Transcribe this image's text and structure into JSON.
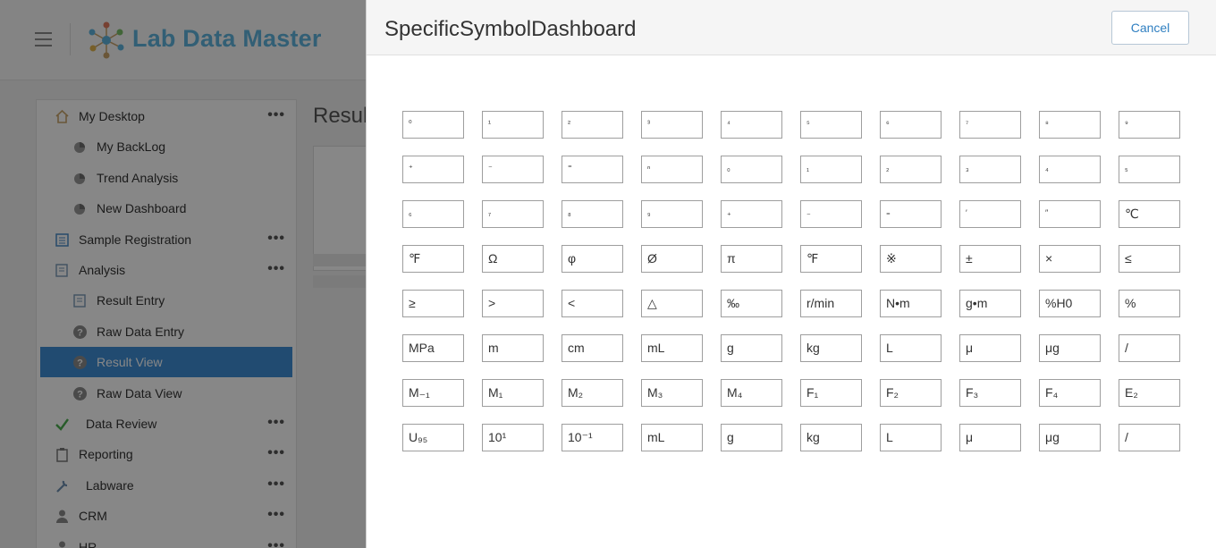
{
  "app": {
    "title": "Lab Data Master",
    "accent": "#5fb3dd"
  },
  "sidebar": {
    "items": [
      {
        "label": "My Desktop",
        "icon": "home-icon",
        "level": 0,
        "menu": true
      },
      {
        "label": "My BackLog",
        "icon": "chart-icon",
        "level": 1
      },
      {
        "label": "Trend Analysis",
        "icon": "chart-icon",
        "level": 1
      },
      {
        "label": "New Dashboard",
        "icon": "chart-icon",
        "level": 1
      },
      {
        "label": "Sample Registration",
        "icon": "form-icon",
        "level": 0,
        "menu": true
      },
      {
        "label": "Analysis",
        "icon": "edit-icon",
        "level": 0,
        "menu": true
      },
      {
        "label": "Result Entry",
        "icon": "edit-icon",
        "level": 1
      },
      {
        "label": "Raw Data Entry",
        "icon": "help-icon",
        "level": 1
      },
      {
        "label": "Result View",
        "icon": "help-icon",
        "level": 1,
        "active": true
      },
      {
        "label": "Raw Data View",
        "icon": "help-icon",
        "level": 1
      },
      {
        "label": "Data Review",
        "icon": "check-icon",
        "level": 0,
        "menu": true
      },
      {
        "label": "Reporting",
        "icon": "clipboard-icon",
        "level": 0,
        "menu": true
      },
      {
        "label": "Labware",
        "icon": "wrench-icon",
        "level": 0,
        "menu": true
      },
      {
        "label": "CRM",
        "icon": "user-icon",
        "level": 0,
        "menu": true
      },
      {
        "label": "HR",
        "icon": "user-icon",
        "level": 0,
        "menu": true
      }
    ],
    "more_label": "•••"
  },
  "content": {
    "title": "Result"
  },
  "modal": {
    "title": "SpecificSymbolDashboard",
    "cancel_label": "Cancel",
    "symbols": [
      [
        "⁰",
        "¹",
        "²",
        "³",
        "⁴",
        "⁵",
        "⁶",
        "⁷",
        "⁸",
        "⁹"
      ],
      [
        "⁺",
        "⁻",
        "⁼",
        "ⁿ",
        "₀",
        "₁",
        "₂",
        "₃",
        "₄",
        "₅"
      ],
      [
        "₆",
        "₇",
        "₈",
        "₉",
        "₊",
        "₋",
        "₌",
        "′",
        "″",
        "℃"
      ],
      [
        "℉",
        "Ω",
        "φ",
        "Ø",
        "π",
        "℉",
        "※",
        "±",
        "×",
        "≤"
      ],
      [
        "≥",
        ">",
        "<",
        "△",
        "‰",
        "r/min",
        "N•m",
        "g•m",
        "%H0",
        "%"
      ],
      [
        "MPa",
        "m",
        "cm",
        "mL",
        "g",
        "kg",
        "L",
        "μ",
        "μg",
        "/"
      ],
      [
        "M₋₁",
        "M₁",
        "M₂",
        "M₃",
        "M₄",
        "F₁",
        "F₂",
        "F₃",
        "F₄",
        "E₂"
      ],
      [
        "U₉₅",
        "10¹",
        "10⁻¹",
        "mL",
        "g",
        "kg",
        "L",
        "μ",
        "μg",
        "/"
      ]
    ]
  }
}
